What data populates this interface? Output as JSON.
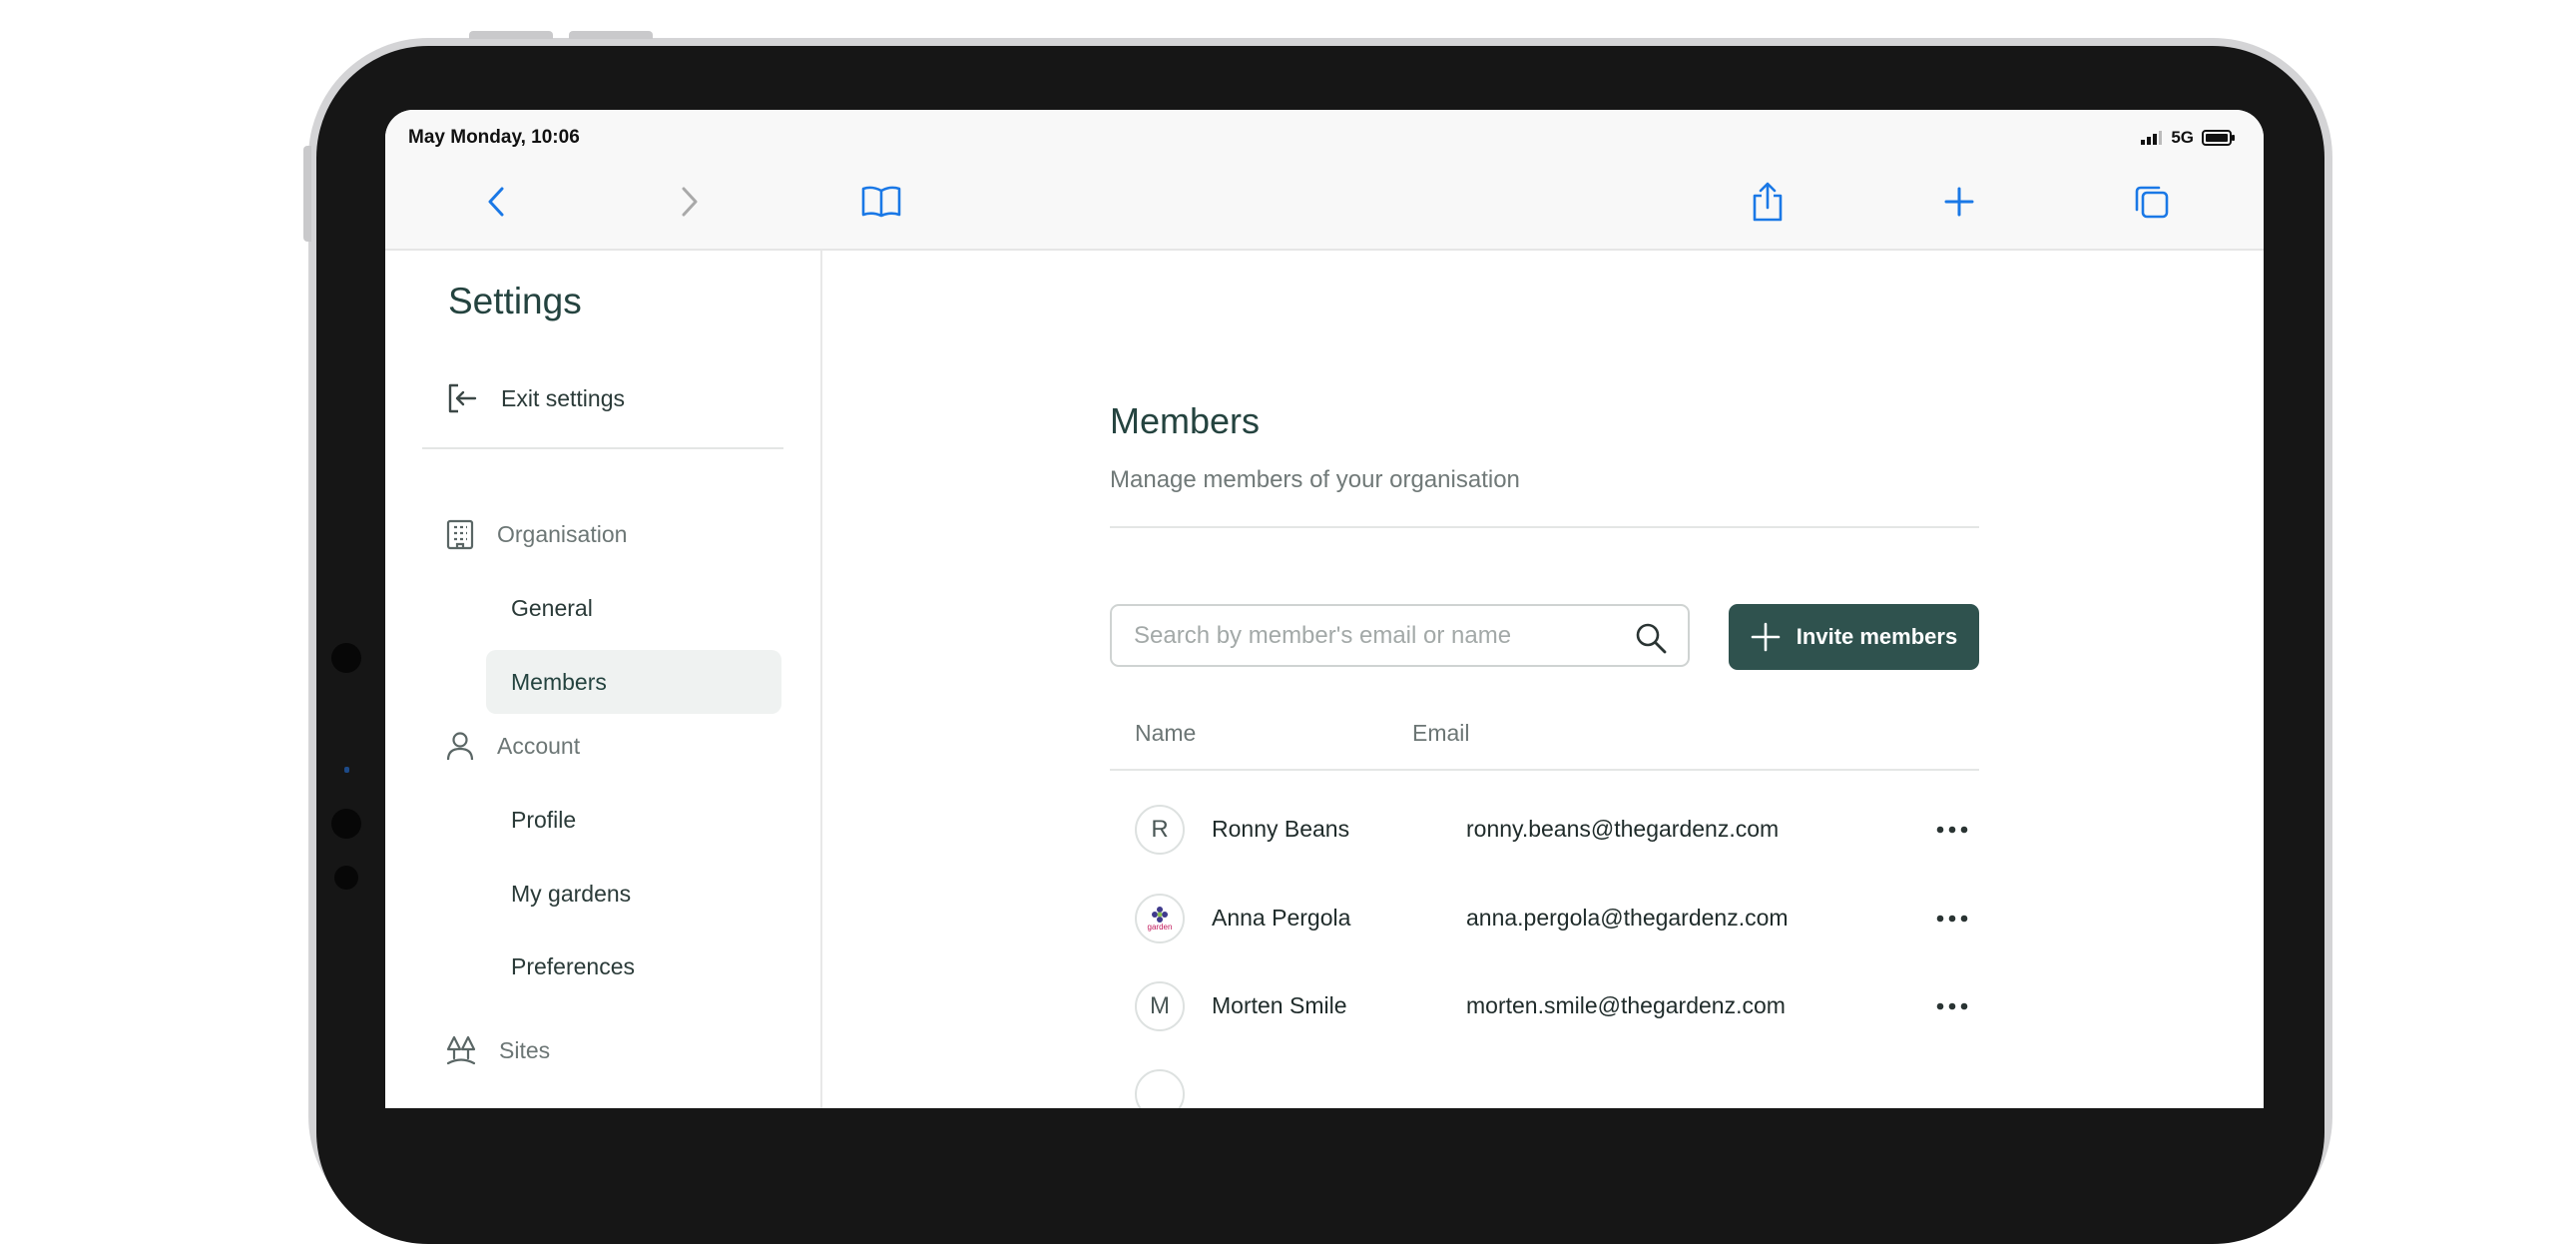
{
  "status_bar": {
    "time": "May Monday, 10:06",
    "network": "5G"
  },
  "browser_toolbar": {
    "back_icon": "chevron-left-icon",
    "forward_icon": "chevron-right-icon",
    "bookmarks_icon": "book-icon",
    "share_icon": "share-icon",
    "new_tab_icon": "plus-icon",
    "tabs_icon": "tabs-icon"
  },
  "sidebar": {
    "title": "Settings",
    "exit_label": "Exit settings",
    "sections": [
      {
        "label": "Organisation",
        "icon": "building-icon",
        "items": [
          "General",
          "Members"
        ]
      },
      {
        "label": "Account",
        "icon": "user-icon",
        "items": [
          "Profile",
          "My gardens",
          "Preferences"
        ]
      },
      {
        "label": "Sites",
        "icon": "trees-icon",
        "items": []
      }
    ],
    "active_item": "Members"
  },
  "main": {
    "title": "Members",
    "subtitle": "Manage members of your organisation",
    "search": {
      "placeholder": "Search by member's email or name",
      "value": ""
    },
    "invite_label": "Invite members",
    "table": {
      "headers": {
        "name": "Name",
        "email": "Email"
      },
      "rows": [
        {
          "avatar": "R",
          "name": "Ronny Beans",
          "email": "ronny.beans@thegardenz.com"
        },
        {
          "avatar": "",
          "avatar_logo_text": "garden",
          "name": "Anna Pergola",
          "email": "anna.pergola@thegardenz.com"
        },
        {
          "avatar": "M",
          "name": "Morten Smile",
          "email": "morten.smile@thegardenz.com"
        }
      ]
    }
  },
  "colors": {
    "accent": "#2f524e",
    "title": "#24433f",
    "link": "#1a78e6"
  }
}
